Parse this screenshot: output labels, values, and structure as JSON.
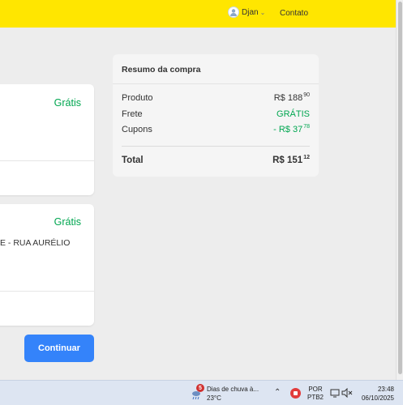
{
  "header": {
    "user_name": "Djan",
    "contact_label": "Contato"
  },
  "shipping_cards": [
    {
      "price_label": "Grátis"
    },
    {
      "price_label": "Grátis",
      "address_snippet": "E - RUA AURÉLIO"
    }
  ],
  "continue_button": {
    "label": "Continuar"
  },
  "summary": {
    "title": "Resumo da compra",
    "rows": [
      {
        "label": "Produto",
        "value": "R$ 188",
        "cents": "90"
      },
      {
        "label": "Frete",
        "value": "GRÁTIS"
      },
      {
        "label": "Cupons",
        "value": "- R$ 37",
        "cents": "78"
      }
    ],
    "total": {
      "label": "Total",
      "value": "R$ 151",
      "cents": "12"
    }
  },
  "taskbar": {
    "weather_badge": "5",
    "weather_text": "Dias de chuva à...",
    "temperature": "23°C",
    "lang_line1": "POR",
    "lang_line2": "PTB2",
    "time": "23:48",
    "date": "06/10/2025"
  },
  "colors": {
    "header_bg": "#ffe600",
    "accent_green": "#00a650",
    "primary_button": "#3483fa"
  }
}
